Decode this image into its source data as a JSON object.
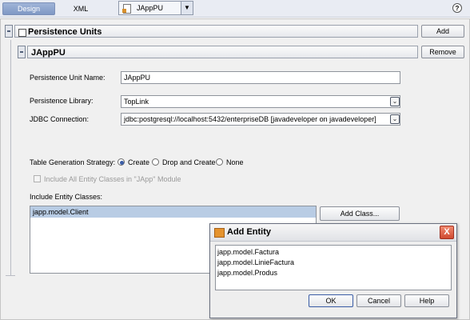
{
  "toolbar": {
    "design_tab": "Design",
    "xml_tab": "XML",
    "file_combo": "JAppPU",
    "help": "?"
  },
  "persistence_units": {
    "title": "Persistence Units",
    "add_button": "Add"
  },
  "unit": {
    "title": "JAppPU",
    "remove_button": "Remove",
    "name_label": "Persistence Unit Name:",
    "name_value": "JAppPU",
    "library_label": "Persistence Library:",
    "library_value": "TopLink",
    "jdbc_label": "JDBC Connection:",
    "jdbc_value": "jdbc:postgresql://localhost:5432/enterpriseDB [javadeveloper on javadeveloper]",
    "strategy_label": "Table Generation Strategy:",
    "strategy_options": [
      "Create",
      "Drop and Create",
      "None"
    ],
    "strategy_selected": "Create",
    "include_all_label": "Include All Entity Classes in \"JApp\" Module",
    "include_label": "Include Entity Classes:",
    "entity_classes": [
      "japp.model.Client"
    ],
    "add_class_button": "Add Class..."
  },
  "dialog": {
    "title": "Add Entity",
    "close": "X",
    "entities": [
      "japp.model.Factura",
      "japp.model.LinieFactura",
      "japp.model.Produs"
    ],
    "ok_button": "OK",
    "cancel_button": "Cancel",
    "help_button": "Help"
  },
  "colors": {
    "selected_row": "#b8cce4",
    "accent": "#3b5da6"
  }
}
